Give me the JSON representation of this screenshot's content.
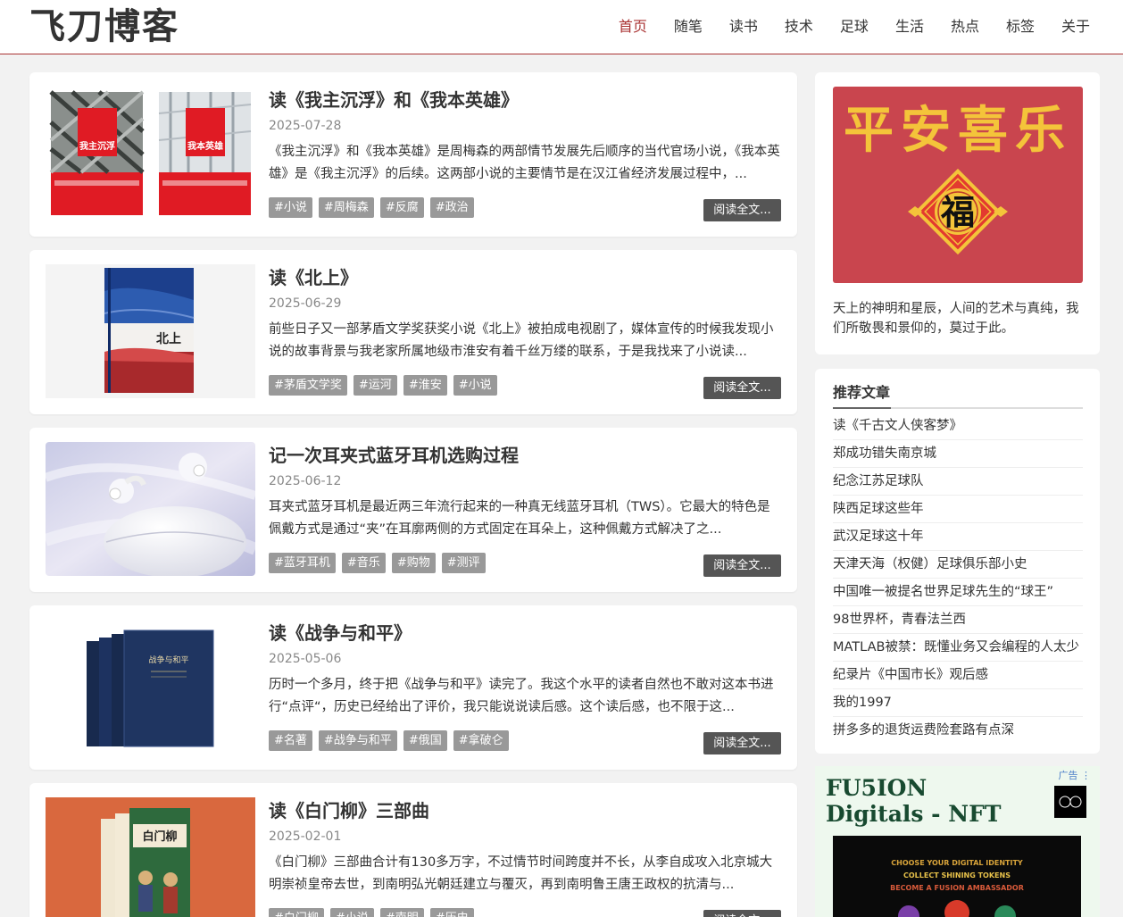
{
  "site": {
    "logo": "飞刀博客"
  },
  "nav": [
    "首页",
    "随笔",
    "读书",
    "技术",
    "足球",
    "生活",
    "热点",
    "标签",
    "关于"
  ],
  "posts": [
    {
      "title": "读《我主沉浮》和《我本英雄》",
      "date": "2025-07-28",
      "excerpt": "《我主沉浮》和《我本英雄》是周梅森的两部情节发展先后顺序的当代官场小说，《我本英雄》是《我主沉浮》的后续。这两部小说的主要情节是在汉江省经济发展过程中，...",
      "tags": [
        "#小说",
        "#周梅森",
        "#反腐",
        "#政治"
      ],
      "read_more": "阅读全文...",
      "thumb_texts": [
        "我主沉浮",
        "我本英雄"
      ]
    },
    {
      "title": "读《北上》",
      "date": "2025-06-29",
      "excerpt": "前些日子又一部茅盾文学奖获奖小说《北上》被拍成电视剧了，媒体宣传的时候我发现小说的故事背景与我老家所属地级市淮安有着千丝万缕的联系，于是我找来了小说读...",
      "tags": [
        "#茅盾文学奖",
        "#运河",
        "#淮安",
        "#小说"
      ],
      "read_more": "阅读全文...",
      "thumb_texts": [
        "北上"
      ]
    },
    {
      "title": "记一次耳夹式蓝牙耳机选购过程",
      "date": "2025-06-12",
      "excerpt": "耳夹式蓝牙耳机是最近两三年流行起来的一种真无线蓝牙耳机（TWS）。它最大的特色是佩戴方式是通过“夹”在耳廓两侧的方式固定在耳朵上，这种佩戴方式解决了之...",
      "tags": [
        "#蓝牙耳机",
        "#音乐",
        "#购物",
        "#测评"
      ],
      "read_more": "阅读全文...",
      "thumb_texts": []
    },
    {
      "title": "读《战争与和平》",
      "date": "2025-05-06",
      "excerpt": "历时一个多月，终于把《战争与和平》读完了。我这个水平的读者自然也不敢对这本书进行“点评“，历史已经给出了评价，我只能说说读后感。这个读后感，也不限于这...",
      "tags": [
        "#名著",
        "#战争与和平",
        "#俄国",
        "#拿破仑"
      ],
      "read_more": "阅读全文...",
      "thumb_texts": [
        "战争与和平"
      ]
    },
    {
      "title": "读《白门柳》三部曲",
      "date": "2025-02-01",
      "excerpt": "《白门柳》三部曲合计有130多万字，不过情节时间跨度并不长，从李自成攻入北京城大明崇祯皇帝去世，到南明弘光朝廷建立与覆灭，再到南明鲁王唐王政权的抗清与...",
      "tags": [
        "#白门柳",
        "#小说",
        "#南明",
        "#历史"
      ],
      "read_more": "阅读全文...",
      "thumb_texts": [
        "白门柳"
      ]
    }
  ],
  "sidebar": {
    "blessing": {
      "text": "平安喜乐",
      "fu": "福"
    },
    "motto": "天上的神明和星辰，人间的艺术与真纯，我们所敬畏和景仰的，莫过于此。",
    "recommended": {
      "title": "推荐文章",
      "items": [
        "读《千古文人侠客梦》",
        "郑成功错失南京城",
        "纪念江苏足球队",
        "陕西足球这些年",
        "武汉足球这十年",
        "天津天海（权健）足球俱乐部小史",
        "中国唯一被提名世界足球先生的“球王”",
        "98世界杯，青春法兰西",
        "MATLAB被禁：既懂业务又会编程的人太少",
        "纪录片《中国市长》观后感",
        "我的1997",
        "拼多多的退货运费险套路有点深"
      ]
    },
    "ad": {
      "label": "广告",
      "title": "FU5ION Digitals - NFT",
      "lines": [
        "CHOOSE YOUR DIGITAL IDENTITY",
        "COLLECT SHINING TOKENS",
        "BECOME A FUSION AMBASSADOR"
      ]
    }
  },
  "colors": {
    "accent": "#aa3333",
    "tag_bg": "#999999",
    "button_bg": "#555555"
  }
}
